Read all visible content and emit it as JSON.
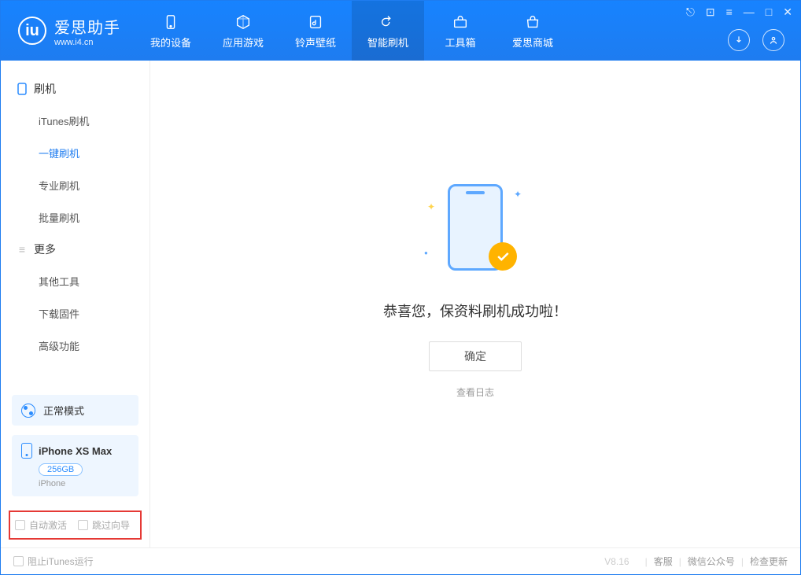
{
  "app": {
    "title": "爱思助手",
    "url": "www.i4.cn"
  },
  "nav": {
    "items": [
      {
        "label": "我的设备",
        "icon": "device"
      },
      {
        "label": "应用游戏",
        "icon": "cube"
      },
      {
        "label": "铃声壁纸",
        "icon": "music"
      },
      {
        "label": "智能刷机",
        "icon": "refresh",
        "active": true
      },
      {
        "label": "工具箱",
        "icon": "toolbox"
      },
      {
        "label": "爱思商城",
        "icon": "store"
      }
    ]
  },
  "sidebar": {
    "section1": {
      "title": "刷机"
    },
    "items1": [
      {
        "label": "iTunes刷机"
      },
      {
        "label": "一键刷机",
        "active": true
      },
      {
        "label": "专业刷机"
      },
      {
        "label": "批量刷机"
      }
    ],
    "section2": {
      "title": "更多"
    },
    "items2": [
      {
        "label": "其他工具"
      },
      {
        "label": "下载固件"
      },
      {
        "label": "高级功能"
      }
    ],
    "mode_label": "正常模式",
    "device": {
      "name": "iPhone XS Max",
      "storage": "256GB",
      "type": "iPhone"
    },
    "checkbox1": "自动激活",
    "checkbox2": "跳过向导"
  },
  "main": {
    "success_message": "恭喜您，保资料刷机成功啦！",
    "ok_button": "确定",
    "view_log": "查看日志"
  },
  "footer": {
    "block_itunes": "阻止iTunes运行",
    "version": "V8.16",
    "link1": "客服",
    "link2": "微信公众号",
    "link3": "检查更新"
  }
}
